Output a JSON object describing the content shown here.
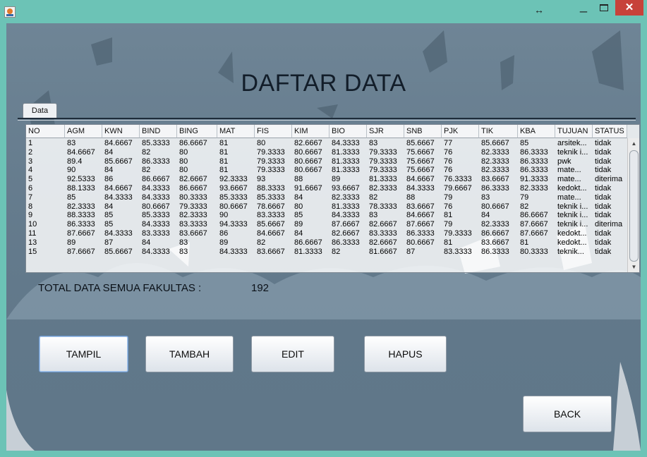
{
  "window": {
    "resize_glyph": "↔",
    "minimize_glyph": "_",
    "close_glyph": "✕"
  },
  "heading": "DAFTAR DATA",
  "tab_label": "Data",
  "table": {
    "columns": [
      "NO",
      "AGM",
      "KWN",
      "BIND",
      "BING",
      "MAT",
      "FIS",
      "KIM",
      "BIO",
      "SJR",
      "SNB",
      "PJK",
      "TIK",
      "KBA",
      "TUJUAN",
      "STATUS"
    ],
    "rows": [
      [
        "1",
        "83",
        "84.6667",
        "85.3333",
        "86.6667",
        "81",
        "80",
        "82.6667",
        "84.3333",
        "83",
        "85.6667",
        "77",
        "85.6667",
        "85",
        "arsitek...",
        "tidak"
      ],
      [
        "2",
        "84.6667",
        "84",
        "82",
        "80",
        "81",
        "79.3333",
        "80.6667",
        "81.3333",
        "79.3333",
        "75.6667",
        "76",
        "82.3333",
        "86.3333",
        "teknik i...",
        "tidak"
      ],
      [
        "3",
        "89.4",
        "85.6667",
        "86.3333",
        "80",
        "81",
        "79.3333",
        "80.6667",
        "81.3333",
        "79.3333",
        "75.6667",
        "76",
        "82.3333",
        "86.3333",
        "pwk",
        "tidak"
      ],
      [
        "4",
        "90",
        "84",
        "82",
        "80",
        "81",
        "79.3333",
        "80.6667",
        "81.3333",
        "79.3333",
        "75.6667",
        "76",
        "82.3333",
        "86.3333",
        "mate...",
        "tidak"
      ],
      [
        "5",
        "92.5333",
        "86",
        "86.6667",
        "82.6667",
        "92.3333",
        "93",
        "88",
        "89",
        "81.3333",
        "84.6667",
        "76.3333",
        "83.6667",
        "91.3333",
        "mate...",
        "diterima"
      ],
      [
        "6",
        "88.1333",
        "84.6667",
        "84.3333",
        "86.6667",
        "93.6667",
        "88.3333",
        "91.6667",
        "93.6667",
        "82.3333",
        "84.3333",
        "79.6667",
        "86.3333",
        "82.3333",
        "kedokt...",
        "tidak"
      ],
      [
        "7",
        "85",
        "84.3333",
        "84.3333",
        "80.3333",
        "85.3333",
        "85.3333",
        "84",
        "82.3333",
        "82",
        "88",
        "79",
        "83",
        "79",
        "mate...",
        "tidak"
      ],
      [
        "8",
        "82.3333",
        "84",
        "80.6667",
        "79.3333",
        "80.6667",
        "78.6667",
        "80",
        "81.3333",
        "78.3333",
        "83.6667",
        "76",
        "80.6667",
        "82",
        "teknik i...",
        "tidak"
      ],
      [
        "9",
        "88.3333",
        "85",
        "85.3333",
        "82.3333",
        "90",
        "83.3333",
        "85",
        "84.3333",
        "83",
        "84.6667",
        "81",
        "84",
        "86.6667",
        "teknik i...",
        "tidak"
      ],
      [
        "10",
        "86.3333",
        "85",
        "84.3333",
        "83.3333",
        "94.3333",
        "85.6667",
        "89",
        "87.6667",
        "82.6667",
        "87.6667",
        "79",
        "82.3333",
        "87.6667",
        "teknik i...",
        "diterima"
      ],
      [
        "11",
        "87.6667",
        "84.3333",
        "83.3333",
        "83.6667",
        "86",
        "84.6667",
        "84",
        "82.6667",
        "83.3333",
        "86.3333",
        "79.3333",
        "86.6667",
        "87.6667",
        "kedokt...",
        "tidak"
      ],
      [
        "13",
        "89",
        "87",
        "84",
        "83",
        "89",
        "82",
        "86.6667",
        "86.3333",
        "82.6667",
        "80.6667",
        "81",
        "83.6667",
        "81",
        "kedokt...",
        "tidak"
      ],
      [
        "15",
        "87.6667",
        "85.6667",
        "84.3333",
        "83",
        "84.3333",
        "83.6667",
        "81.3333",
        "82",
        "81.6667",
        "87",
        "83.3333",
        "86.3333",
        "80.3333",
        "teknik...",
        "tidak"
      ]
    ]
  },
  "total": {
    "label": "TOTAL DATA SEMUA FAKULTAS  :",
    "value": "192"
  },
  "buttons": {
    "tampil": "TAMPIL",
    "tambah": "TAMBAH",
    "edit": "EDIT",
    "hapus": "HAPUS",
    "back": "BACK"
  }
}
